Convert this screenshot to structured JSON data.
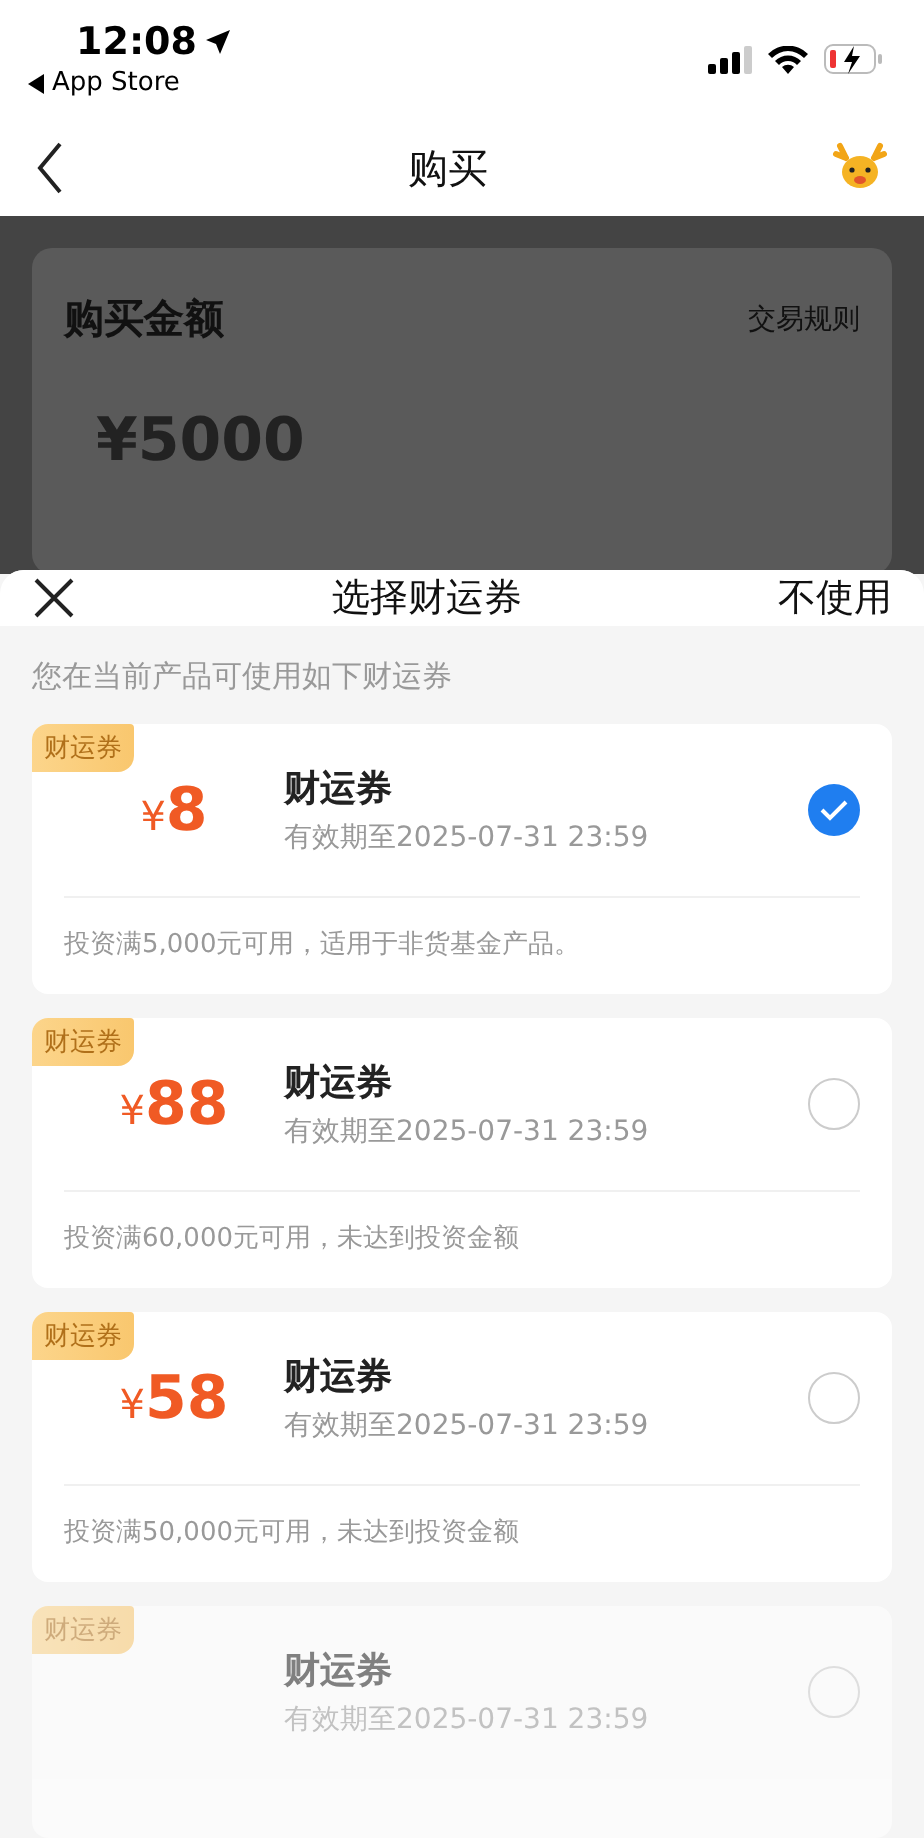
{
  "status_bar": {
    "time": "12:08",
    "back_app": "App Store"
  },
  "nav": {
    "title": "购买"
  },
  "background": {
    "section_title": "购买金额",
    "rules_link": "交易规则",
    "amount": "¥5000"
  },
  "sheet": {
    "title": "选择财运券",
    "skip": "不使用",
    "hint": "您在当前产品可使用如下财运券",
    "coupons": [
      {
        "tag": "财运券",
        "currency": "¥",
        "amount": "8",
        "name": "财运券",
        "expiry": "有效期至2025-07-31 23:59",
        "note": "投资满5,000元可用，适用于非货基金产品。",
        "selected": true
      },
      {
        "tag": "财运券",
        "currency": "¥",
        "amount": "88",
        "name": "财运券",
        "expiry": "有效期至2025-07-31 23:59",
        "note": "投资满60,000元可用，未达到投资金额",
        "selected": false
      },
      {
        "tag": "财运券",
        "currency": "¥",
        "amount": "58",
        "name": "财运券",
        "expiry": "有效期至2025-07-31 23:59",
        "note": "投资满50,000元可用，未达到投资金额",
        "selected": false
      },
      {
        "tag": "财运券",
        "name": "财运券",
        "expiry": "有效期至2025-07-31 23:59",
        "selected": false
      }
    ]
  }
}
